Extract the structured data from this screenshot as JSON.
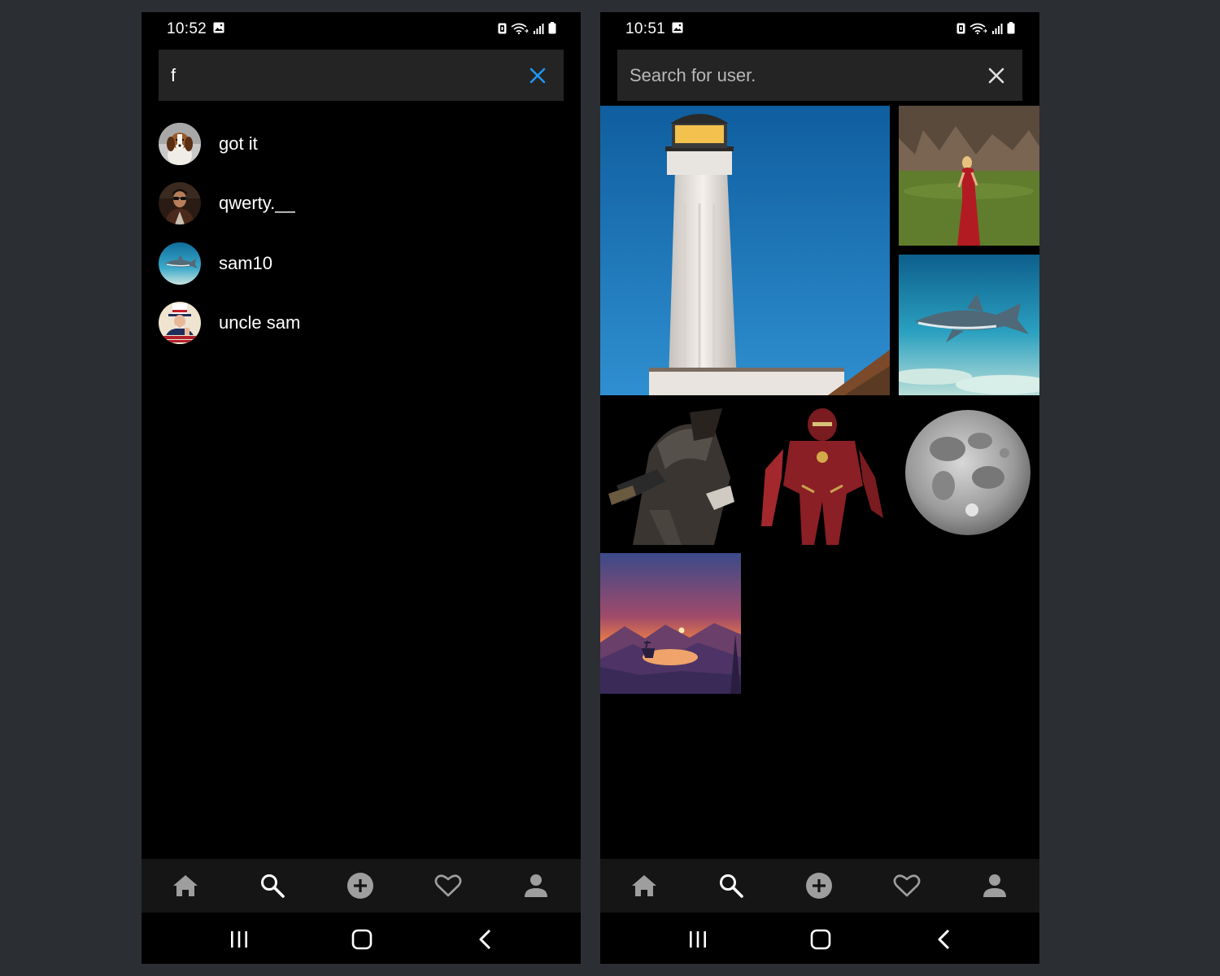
{
  "colors": {
    "page_bg": "#2b2e33",
    "screen_bg": "#000000",
    "search_bg": "#242424",
    "nav_bg": "#151515",
    "accent": "#2196f3",
    "icon_gray": "#9e9e9e"
  },
  "left_screen": {
    "status": {
      "time": "10:52"
    },
    "search": {
      "value": "f",
      "clear_icon": "close-icon"
    },
    "results": [
      {
        "username": "got it",
        "avatar": "beagle-dog"
      },
      {
        "username": "qwerty.__",
        "avatar": "man-sunglasses"
      },
      {
        "username": "sam10",
        "avatar": "shark"
      },
      {
        "username": "uncle sam",
        "avatar": "uncle-sam-poster"
      }
    ]
  },
  "right_screen": {
    "status": {
      "time": "10:51"
    },
    "search": {
      "value": "",
      "placeholder": "Search for user.",
      "clear_icon": "close-icon"
    },
    "grid": [
      "lighthouse",
      "woman-red-dress",
      "shark-underwater",
      "steampunk-gunslinger",
      "iron-man-armor",
      "full-moon",
      "sunset-deer-landscape"
    ]
  },
  "bottom_nav": [
    "home-icon",
    "search-icon",
    "add-circle-icon",
    "heart-icon",
    "person-icon"
  ],
  "system_nav": [
    "recents-icon",
    "home-circle-icon",
    "back-icon"
  ]
}
